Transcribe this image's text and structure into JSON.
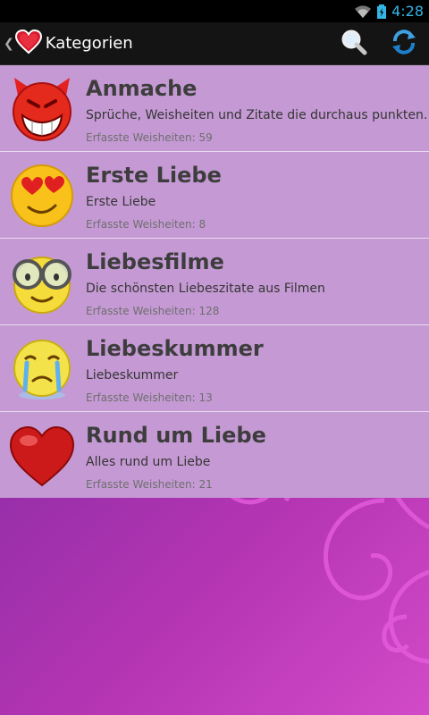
{
  "status_bar": {
    "time": "4:28"
  },
  "action_bar": {
    "title": "Kategorien",
    "search_icon": "search-icon",
    "refresh_icon": "refresh-icon"
  },
  "count_label": "Erfasste Weisheiten:",
  "categories": [
    {
      "name": "Anmache",
      "description": "Sprüche, Weisheiten und Zitate die durchaus punkten.",
      "count": "59",
      "icon": "devil-smiley-icon"
    },
    {
      "name": "Erste Liebe",
      "description": "Erste Liebe",
      "count": "8",
      "icon": "heart-eyes-smiley-icon"
    },
    {
      "name": "Liebesfilme",
      "description": "Die schönsten Liebeszitate aus Filmen",
      "count": "128",
      "icon": "glasses-smiley-icon"
    },
    {
      "name": "Liebeskummer",
      "description": "Liebeskummer",
      "count": "13",
      "icon": "crying-smiley-icon"
    },
    {
      "name": "Rund um Liebe",
      "description": "Alles rund um Liebe",
      "count": "21",
      "icon": "heart-icon"
    }
  ]
}
